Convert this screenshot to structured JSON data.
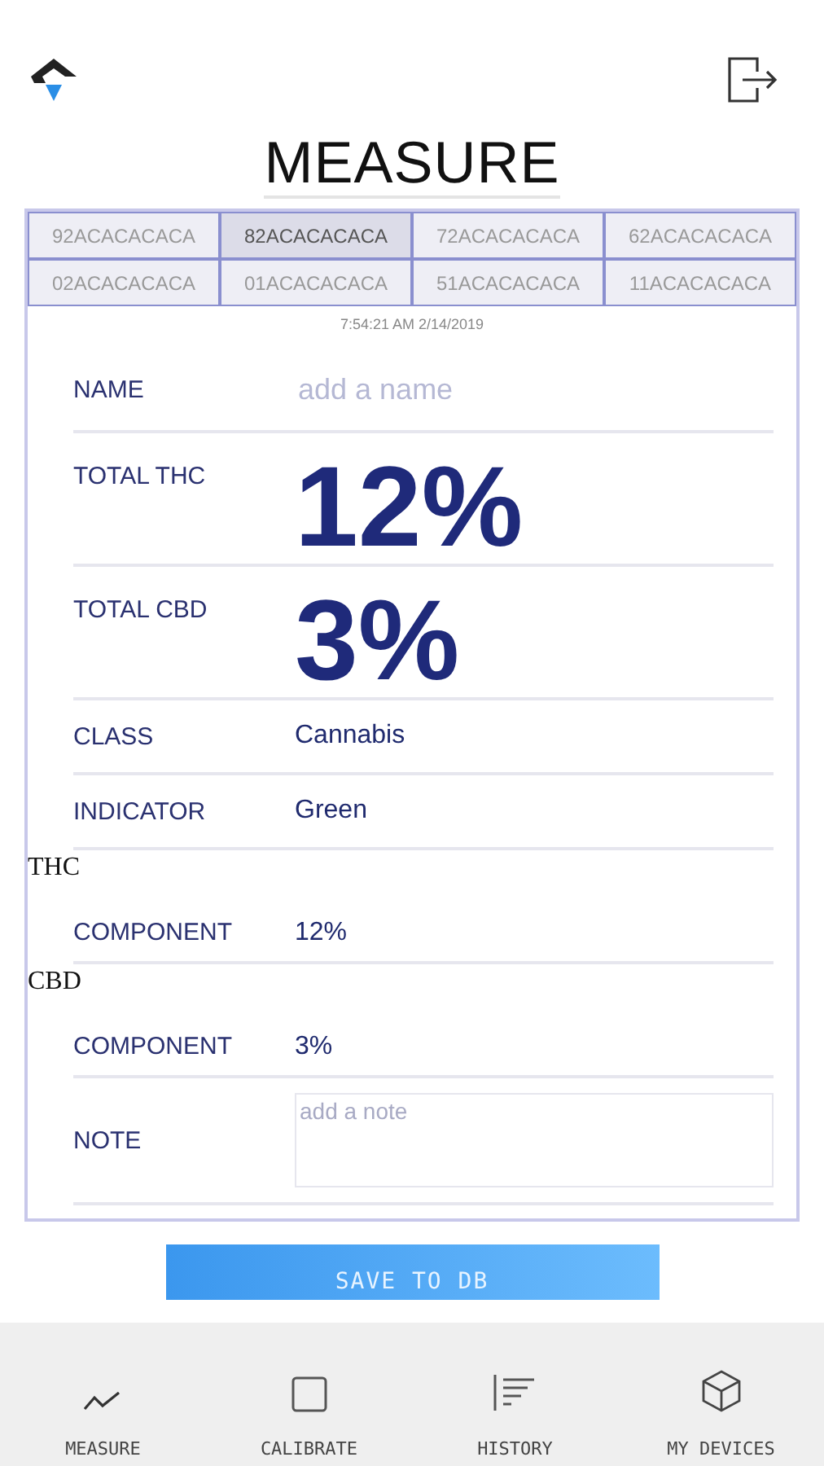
{
  "title": "MEASURE",
  "devices": [
    {
      "label": "92ACACACACA",
      "selected": false
    },
    {
      "label": "82ACACACACA",
      "selected": true
    },
    {
      "label": "72ACACACACA",
      "selected": false
    },
    {
      "label": "62ACACACACA",
      "selected": false
    },
    {
      "label": "02ACACACACA",
      "selected": false
    },
    {
      "label": "01ACACACACA",
      "selected": false
    },
    {
      "label": "51ACACACACA",
      "selected": false
    },
    {
      "label": "11ACACACACA",
      "selected": false
    }
  ],
  "timestamp": "7:54:21 AM 2/14/2019",
  "fields": [
    {
      "kind": "input",
      "label": "NAME",
      "placeholder": "add a name"
    },
    {
      "kind": "big",
      "label": "TOTAL THC",
      "value": "12%"
    },
    {
      "kind": "big",
      "label": "TOTAL CBD",
      "value": "3%"
    },
    {
      "kind": "text",
      "label": "CLASS",
      "value": "Cannabis"
    },
    {
      "kind": "text",
      "label": "INDICATOR",
      "value": "Green"
    },
    {
      "kind": "text",
      "prefix": "THC",
      "label": "COMPONENT",
      "value": "12%"
    },
    {
      "kind": "text",
      "prefix": "CBD",
      "label": "COMPONENT",
      "value": "3%"
    },
    {
      "kind": "note",
      "label": "NOTE",
      "placeholder": "add a note"
    }
  ],
  "save_button": "SAVE TO DB",
  "nav": [
    {
      "label": "MEASURE"
    },
    {
      "label": "CALIBRATE"
    },
    {
      "label": "HISTORY"
    },
    {
      "label": "MY DEVICES"
    }
  ]
}
